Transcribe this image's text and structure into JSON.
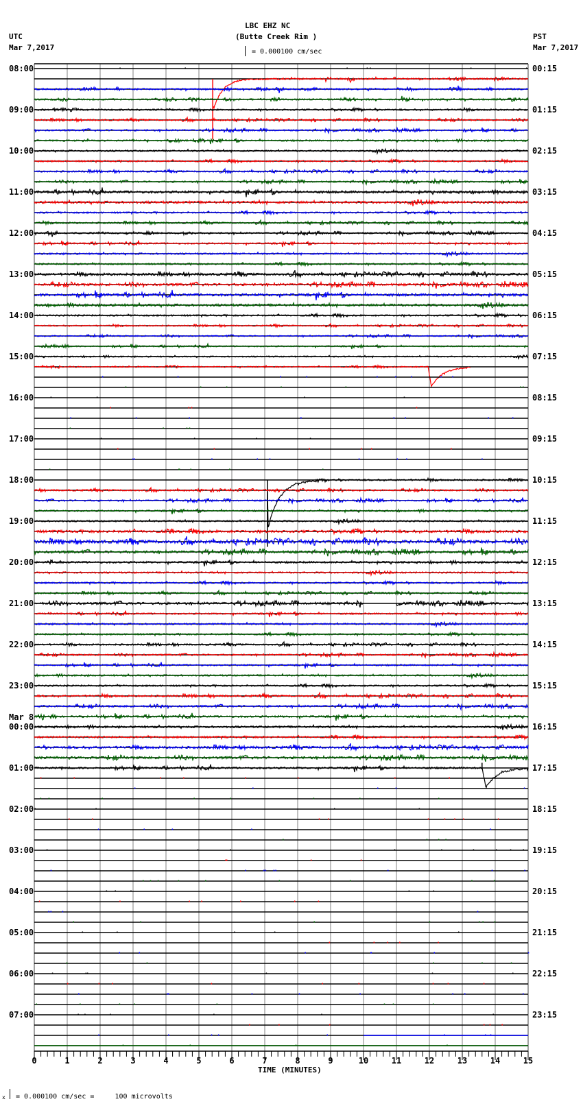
{
  "header": {
    "station": "LBC EHZ NC",
    "location": "(Butte Creek Rim )",
    "left_timezone": "UTC",
    "left_date": "Mar 7,2017",
    "right_timezone": "PST",
    "right_date": "Mar 7,2017",
    "scale_text": "= 0.000100 cm/sec"
  },
  "footer": {
    "scale_text": "= 0.000100 cm/sec =     100 microvolts"
  },
  "chart_data": {
    "type": "line",
    "subtype": "helicorder",
    "title": "LBC EHZ NC",
    "subtitle": "(Butte Creek Rim )",
    "xlabel": "TIME (MINUTES)",
    "xlim": [
      0,
      15
    ],
    "x_ticks": [
      "0",
      "1",
      "2",
      "3",
      "4",
      "5",
      "6",
      "7",
      "8",
      "9",
      "10",
      "11",
      "12",
      "13",
      "14",
      "15"
    ],
    "minor_ticks_per_minute": 5,
    "traces_per_hour": 4,
    "trace_colors": [
      "#000000",
      "#ff0000",
      "#0000ff",
      "#006400"
    ],
    "left_labels": [
      "08:00",
      "09:00",
      "10:00",
      "11:00",
      "12:00",
      "13:00",
      "14:00",
      "15:00",
      "16:00",
      "17:00",
      "18:00",
      "19:00",
      "20:00",
      "21:00",
      "22:00",
      "23:00",
      "00:00",
      "01:00",
      "02:00",
      "03:00",
      "04:00",
      "05:00",
      "06:00",
      "07:00"
    ],
    "date_change_label": {
      "hour_index": 16,
      "text": "Mar 8"
    },
    "right_labels": [
      "00:15",
      "01:15",
      "02:15",
      "03:15",
      "04:15",
      "05:15",
      "06:15",
      "07:15",
      "08:15",
      "09:15",
      "10:15",
      "11:15",
      "12:15",
      "13:15",
      "14:15",
      "15:15",
      "16:15",
      "17:15",
      "18:15",
      "19:15",
      "20:15",
      "21:15",
      "22:15",
      "23:15"
    ],
    "noise_levels": [
      0,
      1,
      1,
      1,
      1,
      1,
      1,
      1,
      1,
      1,
      1,
      1,
      1.5,
      1.5,
      1,
      1,
      1,
      1,
      1,
      1,
      1.5,
      1.5,
      1.6,
      1.5,
      1,
      0.8,
      0.8,
      0.8,
      0.8,
      0.8,
      0,
      0,
      0,
      0,
      0,
      0,
      0,
      0,
      0,
      0,
      1,
      1,
      1,
      1,
      1,
      1.6,
      2,
      1.6,
      1.2,
      1,
      1,
      1,
      1.5,
      1,
      1,
      1,
      1,
      1,
      1,
      1,
      1,
      1.2,
      1.2,
      1.2,
      1.2,
      1.2,
      1.5,
      1.5,
      1.2,
      0,
      0,
      0,
      0,
      0,
      0,
      0,
      0,
      0,
      0,
      0,
      0,
      0,
      0,
      0,
      0,
      0,
      0,
      0,
      0,
      0,
      0,
      0,
      0,
      0,
      0,
      0
    ],
    "data_windows": [
      {
        "trace": 1,
        "start": 5.42,
        "end": 15
      },
      {
        "trace": 29,
        "start": 0,
        "end": 13.27
      },
      {
        "trace": 40,
        "start": 7.08,
        "end": 15
      },
      {
        "trace": 52,
        "gap": [
          10.0,
          11.0
        ]
      },
      {
        "trace": 68,
        "start": 0,
        "end": 15
      }
    ],
    "flat_colored": [
      {
        "trace": 94,
        "start": 10,
        "end": 15
      },
      {
        "trace": 95,
        "start": 0,
        "end": 15
      }
    ],
    "events": [
      {
        "trace": 1,
        "onset": 5.42,
        "spike": 5.9,
        "initial": 3.0,
        "rise": 0.02,
        "tau": 0.28,
        "end": 15
      },
      {
        "trace": 29,
        "onset": 11.96,
        "spike": 0,
        "initial": 1.9,
        "rise": 0.1,
        "tau": 0.35,
        "end": 13.27
      },
      {
        "trace": 40,
        "onset": 7.08,
        "spike": 6.5,
        "initial": 4.7,
        "rise": 0.02,
        "tau": 0.35,
        "end": 15
      },
      {
        "trace": 68,
        "onset": 13.6,
        "spike": -0.5,
        "initial": 1.9,
        "rise": 0.12,
        "tau": 0.35,
        "end": 15
      }
    ]
  }
}
